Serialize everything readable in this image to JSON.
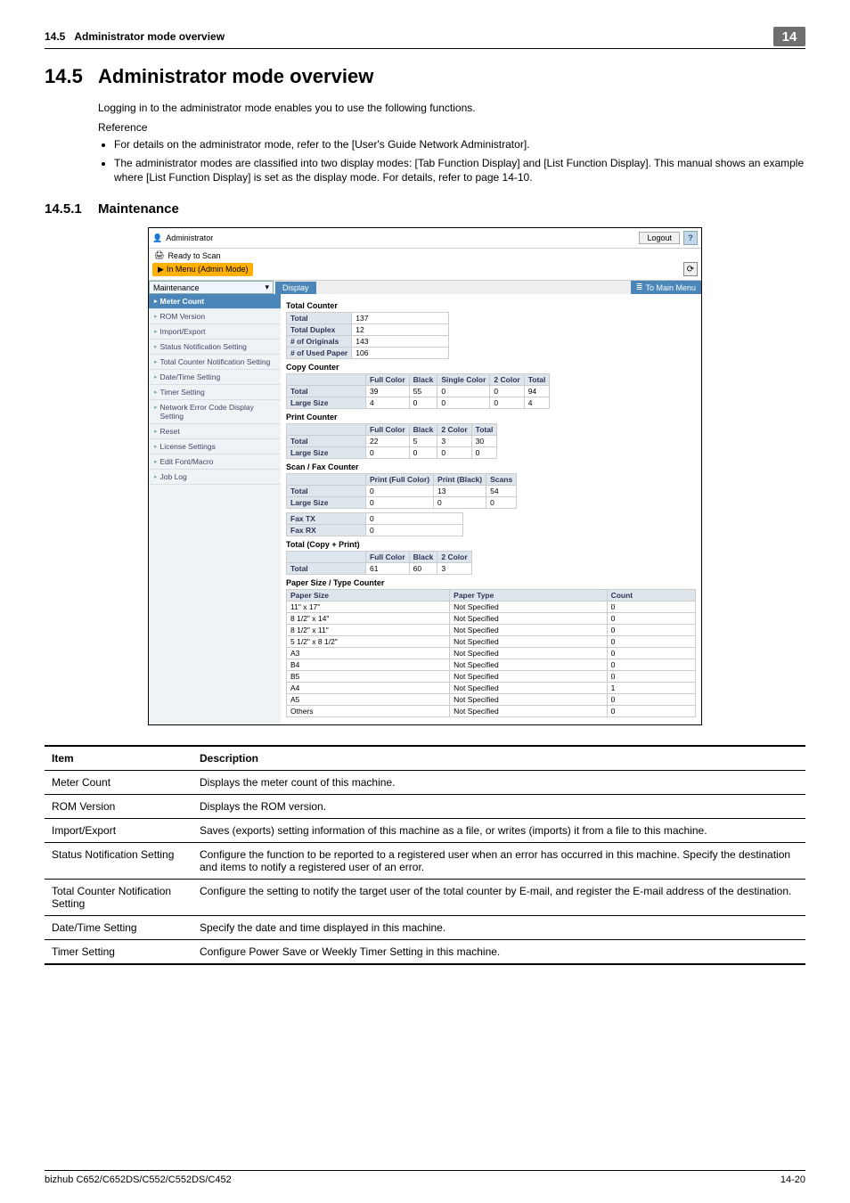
{
  "header": {
    "section_no": "14.5",
    "section_title": "Administrator mode overview",
    "badge": "14"
  },
  "h1": {
    "num": "14.5",
    "title": "Administrator mode overview"
  },
  "intro": {
    "line1": "Logging in to the administrator mode enables you to use the following functions.",
    "ref": "Reference",
    "bullets": [
      "For details on the administrator mode, refer to the [User's Guide Network Administrator].",
      "The administrator modes are classified into two display modes: [Tab Function Display] and [List Function Display]. This manual shows an example where [List Function Display] is set as the display mode. For details, refer to page 14-10."
    ]
  },
  "h2": {
    "num": "14.5.1",
    "title": "Maintenance"
  },
  "shot": {
    "admin": "Administrator",
    "logout": "Logout",
    "status": "Ready to Scan",
    "menu_pill": "In Menu (Admin Mode)",
    "dd": "Maintenance",
    "display_btn": "Display",
    "to_main": "To Main Menu",
    "nav": [
      "Meter Count",
      "ROM Version",
      "Import/Export",
      "Status Notification Setting",
      "Total Counter Notification Setting",
      "Date/Time Setting",
      "Timer Setting",
      "Network Error Code Display Setting",
      "Reset",
      "License Settings",
      "Edit Font/Macro",
      "Job Log"
    ],
    "total_counter": {
      "title": "Total Counter",
      "rows": [
        [
          "Total",
          "137"
        ],
        [
          "Total Duplex",
          "12"
        ],
        [
          "# of Originals",
          "143"
        ],
        [
          "# of Used Paper",
          "106"
        ]
      ]
    },
    "copy_counter": {
      "title": "Copy Counter",
      "head": [
        "",
        "Full Color",
        "Black",
        "Single Color",
        "2 Color",
        "Total"
      ],
      "rows": [
        [
          "Total",
          "39",
          "55",
          "0",
          "0",
          "94"
        ],
        [
          "Large Size",
          "4",
          "0",
          "0",
          "0",
          "4"
        ]
      ]
    },
    "print_counter": {
      "title": "Print Counter",
      "head": [
        "",
        "Full Color",
        "Black",
        "2 Color",
        "Total"
      ],
      "rows": [
        [
          "Total",
          "22",
          "5",
          "3",
          "30"
        ],
        [
          "Large Size",
          "0",
          "0",
          "0",
          "0"
        ]
      ]
    },
    "scan_fax": {
      "title": "Scan / Fax Counter",
      "head": [
        "",
        "Print (Full Color)",
        "Print (Black)",
        "Scans"
      ],
      "rows": [
        [
          "Total",
          "0",
          "13",
          "54"
        ],
        [
          "Large Size",
          "0",
          "0",
          "0"
        ]
      ]
    },
    "fax": {
      "rows": [
        [
          "Fax TX",
          "0"
        ],
        [
          "Fax RX",
          "0"
        ]
      ]
    },
    "total_cp": {
      "title": "Total (Copy + Print)",
      "head": [
        "",
        "Full Color",
        "Black",
        "2 Color"
      ],
      "rows": [
        [
          "Total",
          "61",
          "60",
          "3"
        ]
      ]
    },
    "paper": {
      "title": "Paper Size / Type Counter",
      "head": [
        "Paper Size",
        "Paper Type",
        "Count"
      ],
      "rows": [
        [
          "11\" x 17\"",
          "Not Specified",
          "0"
        ],
        [
          "8 1/2\" x 14\"",
          "Not Specified",
          "0"
        ],
        [
          "8 1/2\" x 11\"",
          "Not Specified",
          "0"
        ],
        [
          "5 1/2\" x 8 1/2\"",
          "Not Specified",
          "0"
        ],
        [
          "A3",
          "Not Specified",
          "0"
        ],
        [
          "B4",
          "Not Specified",
          "0"
        ],
        [
          "B5",
          "Not Specified",
          "0"
        ],
        [
          "A4",
          "Not Specified",
          "1"
        ],
        [
          "A5",
          "Not Specified",
          "0"
        ],
        [
          "Others",
          "Not Specified",
          "0"
        ]
      ]
    }
  },
  "table": {
    "head": [
      "Item",
      "Description"
    ],
    "rows": [
      [
        "Meter Count",
        "Displays the meter count of this machine."
      ],
      [
        "ROM Version",
        "Displays the ROM version."
      ],
      [
        "Import/Export",
        "Saves (exports) setting information of this machine as a file, or writes (imports) it from a file to this machine."
      ],
      [
        "Status Notification Setting",
        "Configure the function to be reported to a registered user when an error has occurred in this machine. Specify the destination and items to notify a registered user of an error."
      ],
      [
        "Total Counter Notification Setting",
        "Configure the setting to notify the target user of the total counter by E-mail, and register the E-mail address of the destination."
      ],
      [
        "Date/Time Setting",
        "Specify the date and time displayed in this machine."
      ],
      [
        "Timer Setting",
        "Configure Power Save or Weekly Timer Setting in this machine."
      ]
    ]
  },
  "footer": {
    "model": "bizhub C652/C652DS/C552/C552DS/C452",
    "page": "14-20"
  }
}
